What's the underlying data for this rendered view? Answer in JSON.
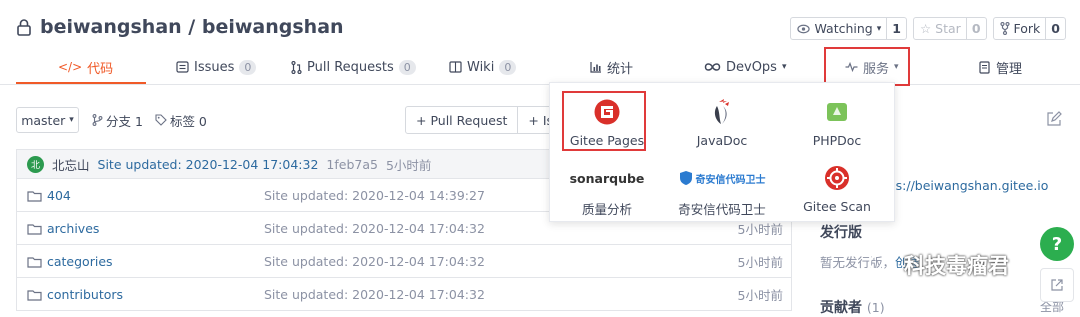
{
  "repo": {
    "title": "beiwangshan / beiwangshan"
  },
  "actions": {
    "watch": {
      "label": "Watching",
      "count": "1"
    },
    "star": {
      "label": "Star",
      "count": "0"
    },
    "fork": {
      "label": "Fork",
      "count": "0"
    }
  },
  "nav": {
    "code": "代码",
    "issues": {
      "label": "Issues",
      "count": "0"
    },
    "pulls": {
      "label": "Pull Requests",
      "count": "0"
    },
    "wiki": {
      "label": "Wiki",
      "count": "0"
    },
    "stats": "统计",
    "devops": "DevOps",
    "services": "服务",
    "manage": "管理"
  },
  "toolbar": {
    "branch": "master",
    "branches": "分支 1",
    "tags": "标签 0",
    "pull_request": "+ Pull Request",
    "issue": "+ Issue"
  },
  "commit": {
    "avatar": "北",
    "author": "北忘山",
    "message": "Site updated: 2020-12-04 17:04:32",
    "sha": "1feb7a5",
    "ago": "5小时前"
  },
  "files": [
    {
      "name": "404",
      "message": "Site updated: 2020-12-04 14:39:27",
      "ago": ""
    },
    {
      "name": "archives",
      "message": "Site updated: 2020-12-04 17:04:32",
      "ago": "5小时前"
    },
    {
      "name": "categories",
      "message": "Site updated: 2020-12-04 17:04:32",
      "ago": "5小时前"
    },
    {
      "name": "contributors",
      "message": "Site updated: 2020-12-04 17:04:32",
      "ago": "5小时前"
    }
  ],
  "services_menu": {
    "gitee_pages": "Gitee Pages",
    "javadoc": "JavaDoc",
    "phpdoc": "PHPDoc",
    "sonarqube_logo": "sonarqube",
    "quality": "质量分析",
    "qianxin_logo": "奇安信代码卫士",
    "qianxin": "奇安信代码卫士",
    "gitee_scan": "Gitee Scan"
  },
  "sidebar": {
    "homepage": "https://beiwangshan.gitee.io",
    "releases_title": "发行版",
    "releases_text": "暂无发行版，",
    "releases_create": "创建",
    "contributors_title": "贡献者",
    "contributors_count": "(1)",
    "contributors_all": "全部"
  },
  "watermark": "科技毒瘤君",
  "colors": {
    "accent": "#f05a28",
    "link": "#2d6a9f",
    "highlight": "#e03a3a",
    "success": "#2cae4f"
  }
}
